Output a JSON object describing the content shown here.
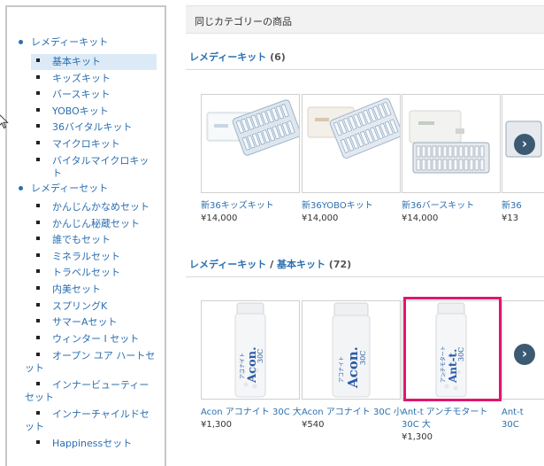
{
  "sidebar": {
    "categories": [
      {
        "label": "レメディーキット",
        "items": [
          {
            "label": "基本キット"
          },
          {
            "label": "キッズキット"
          },
          {
            "label": "バースキット"
          },
          {
            "label": "YOBOキット"
          },
          {
            "label": "36バイタルキット"
          },
          {
            "label": "マイクロキット"
          },
          {
            "label": "バイタルマイクロキット"
          }
        ]
      },
      {
        "label": "レメディーセット",
        "items": [
          {
            "label": "かんじんかなめセット"
          },
          {
            "label": "かんじん秘蔵セット"
          },
          {
            "label": "誰でもセット"
          },
          {
            "label": "ミネラルセット"
          },
          {
            "label": "トラベルセット"
          },
          {
            "label": "内美セット"
          },
          {
            "label": "スプリングK"
          },
          {
            "label": "サマーAセット"
          },
          {
            "label": "ウィンター I セット"
          },
          {
            "label": "オープン ユア ハートセット"
          },
          {
            "label": "インナービューティーセット"
          },
          {
            "label": "インナーチャイルドセット"
          },
          {
            "label": "Happinessセット"
          }
        ]
      }
    ]
  },
  "main": {
    "header": "同じカテゴリーの商品",
    "section1": {
      "title": "レメディーキット",
      "count": "(6)",
      "products": [
        {
          "name": "新36キッズキット",
          "price": "¥14,000"
        },
        {
          "name": "新36YOBOキット",
          "price": "¥14,000"
        },
        {
          "name": "新36バースキット",
          "price": "¥14,000"
        },
        {
          "name": "新36",
          "price": "¥13"
        }
      ]
    },
    "section2": {
      "title": "レメディーキット",
      "separator": "/",
      "subtitle": "基本キット",
      "count": "(72)",
      "products": [
        {
          "name": "Acon アコナイト 30C 大",
          "price": "¥1,300",
          "vial_text": "Acon.",
          "vial_sub": "30C",
          "vial_kana": "アコナイト"
        },
        {
          "name": "Acon アコナイト 30C 小",
          "price": "¥540",
          "vial_text": "Acon.",
          "vial_sub": "30C",
          "vial_kana": "アコナイト"
        },
        {
          "name": "Ant-t アンチモタート 30C 大",
          "price": "¥1,300",
          "vial_text": "Ant-t.",
          "vial_sub": "30C",
          "vial_kana": "アンチモタート"
        },
        {
          "name": "Ant-t 30C",
          "price": ""
        }
      ]
    },
    "next_glyph": "›"
  },
  "colors": {
    "link": "#2b6fb0",
    "active_bg": "#dbeaf6",
    "highlight": "#e0166e",
    "next_button": "#3d5a73"
  }
}
